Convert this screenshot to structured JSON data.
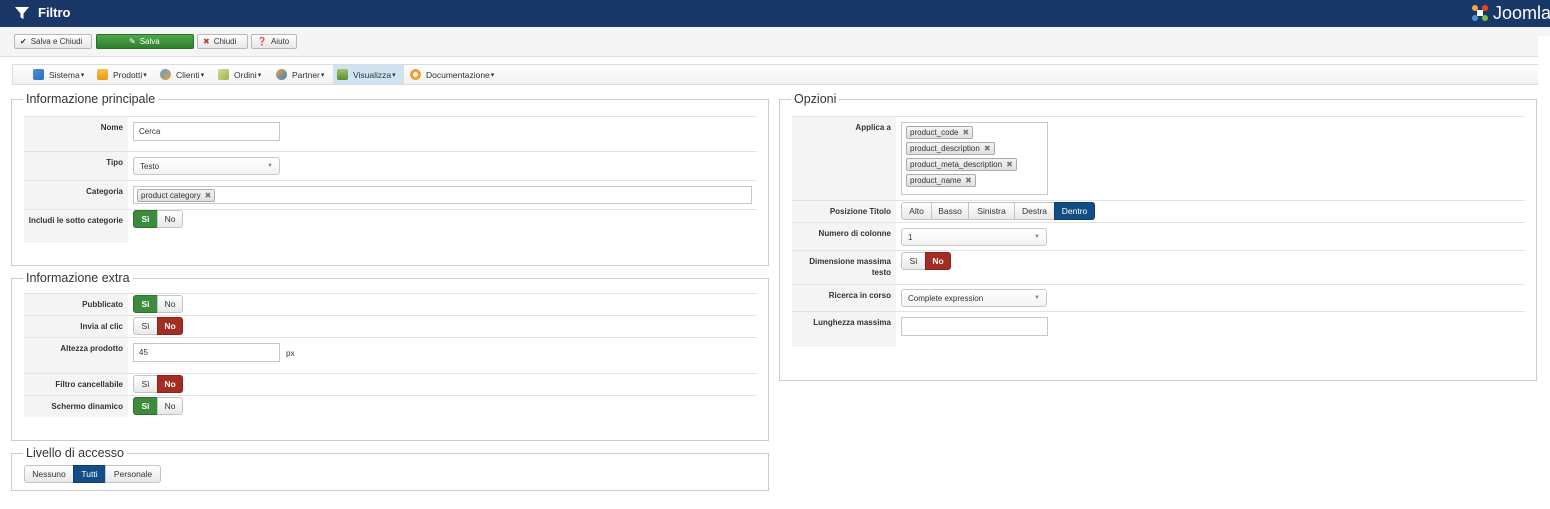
{
  "header": {
    "title": "Filtro",
    "logo_text": "Joomla",
    "bg_color": "#1a3867"
  },
  "toolbar": {
    "save_close": "Salva e Chiudi",
    "save": "Salva",
    "close": "Chiudi",
    "help": "Aiuto"
  },
  "menu": {
    "items": [
      {
        "label": "Sistema",
        "icon": "tools-icon"
      },
      {
        "label": "Prodotti",
        "icon": "product-icon"
      },
      {
        "label": "Clienti",
        "icon": "customers-icon"
      },
      {
        "label": "Ordini",
        "icon": "orders-icon"
      },
      {
        "label": "Partner",
        "icon": "partner-icon"
      },
      {
        "label": "Visualizza",
        "icon": "display-icon"
      },
      {
        "label": "Documentazione",
        "icon": "help-icon"
      }
    ]
  },
  "main_info": {
    "legend": "Informazione principale",
    "name_label": "Nome",
    "name_value": "Cerca",
    "type_label": "Tipo",
    "type_value": "Testo",
    "category_label": "Categoria",
    "category_tag": "product category",
    "subcat_label": "Includi le sotto categorie",
    "yes": "Sì",
    "no": "No"
  },
  "extra_info": {
    "legend": "Informazione extra",
    "published_label": "Pubblicato",
    "submit_label": "Invia al clic",
    "height_label": "Altezza prodotto",
    "height_value": "45",
    "height_unit": "px",
    "cancel_label": "Filtro cancellabile",
    "dynamic_label": "Schermo dinamico",
    "yes": "Sì",
    "no": "No"
  },
  "access": {
    "legend": "Livello di accesso",
    "options": [
      "Nessuno",
      "Tutti",
      "Personale"
    ],
    "selected": "Tutti"
  },
  "options": {
    "legend": "Opzioni",
    "apply_label": "Applica a",
    "apply_tags": [
      "product_code",
      "product_description",
      "product_meta_description",
      "product_name"
    ],
    "title_pos_label": "Posizione Titolo",
    "title_pos_options": [
      "Alto",
      "Basso",
      "Sinistra",
      "Destra",
      "Dentro"
    ],
    "title_pos_selected": "Dentro",
    "columns_label": "Numero di colonne",
    "columns_value": "1",
    "max_text_label": "Dimensione massima testo",
    "search_label": "Ricerca in corso",
    "search_value": "Complete expression",
    "max_length_label": "Lunghezza massima",
    "max_length_value": "",
    "yes": "Sì",
    "no": "No"
  }
}
